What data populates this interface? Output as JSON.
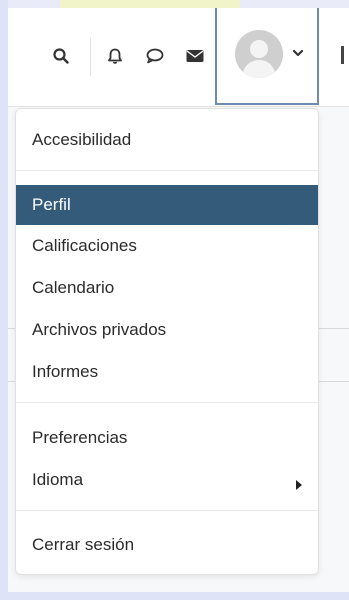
{
  "header": {
    "icons": [
      "search-icon",
      "bell-icon",
      "chat-icon",
      "envelope-icon"
    ],
    "user": {
      "avatar": "user-avatar-placeholder",
      "caret": "chevron-down-icon"
    }
  },
  "user_menu": {
    "items": [
      {
        "label": "Accesibilidad",
        "active": false
      },
      {
        "label": "Perfil",
        "active": true
      },
      {
        "label": "Calificaciones",
        "active": false
      },
      {
        "label": "Calendario",
        "active": false
      },
      {
        "label": "Archivos privados",
        "active": false
      },
      {
        "label": "Informes",
        "active": false
      },
      {
        "label": "Preferencias",
        "active": false
      },
      {
        "label": "Idioma",
        "active": false,
        "submenu": true
      },
      {
        "label": "Cerrar sesión",
        "active": false
      }
    ]
  },
  "colors": {
    "active_bg": "#345c7a",
    "active_text": "#ffffff",
    "toggle_border": "#6c8db0",
    "text": "#2b2b2b"
  }
}
